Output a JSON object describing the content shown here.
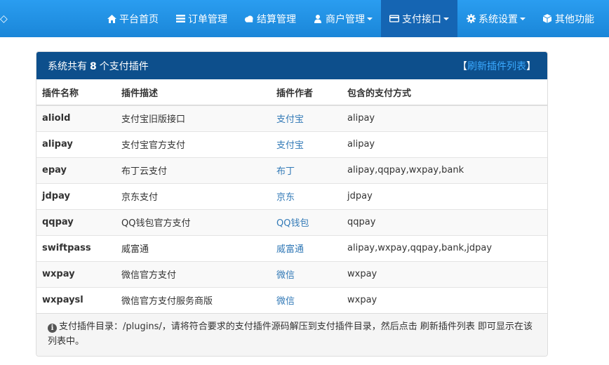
{
  "nav": {
    "left_glyph": "◇",
    "items": [
      {
        "label": "平台首页",
        "icon": "home-icon"
      },
      {
        "label": "订单管理",
        "icon": "list-icon"
      },
      {
        "label": "结算管理",
        "icon": "cloud-icon"
      },
      {
        "label": "商户管理",
        "icon": "user-icon",
        "dropdown": true
      },
      {
        "label": "支付接口",
        "icon": "credit-card-icon",
        "dropdown": true,
        "active": true
      },
      {
        "label": "系统设置",
        "icon": "gear-icon",
        "dropdown": true
      },
      {
        "label": "其他功能",
        "icon": "cube-icon"
      }
    ]
  },
  "panel": {
    "title_prefix": "系统共有",
    "count": "8",
    "title_suffix": "个支付插件",
    "refresh_open": "【",
    "refresh_label": "刷新插件列表",
    "refresh_close": "】"
  },
  "table": {
    "headers": [
      "插件名称",
      "插件描述",
      "插件作者",
      "包含的支付方式"
    ],
    "rows": [
      {
        "name": "aliold",
        "desc": "支付宝旧版接口",
        "author": "支付宝",
        "methods": "alipay"
      },
      {
        "name": "alipay",
        "desc": "支付宝官方支付",
        "author": "支付宝",
        "methods": "alipay"
      },
      {
        "name": "epay",
        "desc": "布丁云支付",
        "author": "布丁",
        "methods": "alipay,qqpay,wxpay,bank"
      },
      {
        "name": "jdpay",
        "desc": "京东支付",
        "author": "京东",
        "methods": "jdpay"
      },
      {
        "name": "qqpay",
        "desc": "QQ钱包官方支付",
        "author": "QQ钱包",
        "methods": "qqpay"
      },
      {
        "name": "swiftpass",
        "desc": "威富通",
        "author": "威富通",
        "methods": "alipay,wxpay,qqpay,bank,jdpay"
      },
      {
        "name": "wxpay",
        "desc": "微信官方支付",
        "author": "微信",
        "methods": "wxpay"
      },
      {
        "name": "wxpaysl",
        "desc": "微信官方支付服务商版",
        "author": "微信",
        "methods": "wxpay"
      }
    ]
  },
  "note": "支付插件目录：/plugins/，请将符合要求的支付插件源码解压到支付插件目录，然后点击 刷新插件列表 即可显示在该列表中。"
}
